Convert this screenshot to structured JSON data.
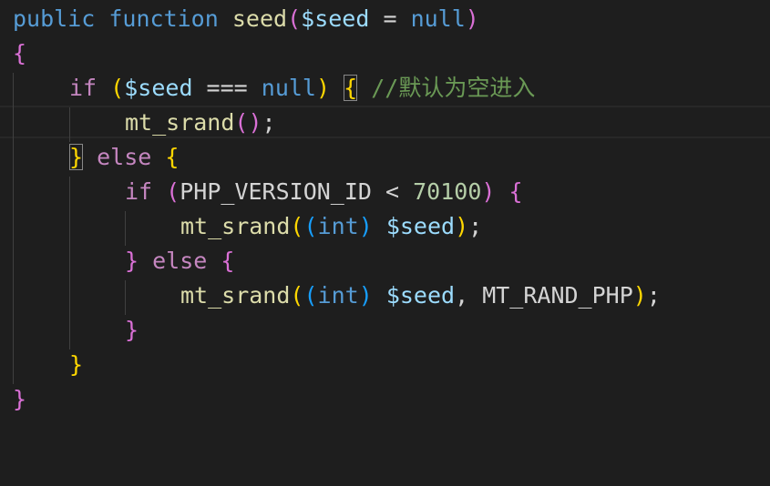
{
  "editor": {
    "language": "php",
    "theme": {
      "background": "#1e1e1e",
      "keyword": "#569cd6",
      "control": "#c586c0",
      "function": "#dcdcaa",
      "variable": "#9cdcfe",
      "number": "#b5cea8",
      "comment": "#6a9955",
      "bracket_level_1": "#da70d6",
      "bracket_level_2": "#ffd700",
      "bracket_level_3": "#179fff"
    },
    "lines": [
      {
        "kw_public": "public",
        "kw_function": "function",
        "fn_name": "seed",
        "open_paren": "(",
        "param": "$seed",
        "eq": " = ",
        "default": "null",
        "close_paren": ")"
      },
      {
        "brace": "{"
      },
      {
        "kw_if": "if",
        "open_paren": "(",
        "var": "$seed",
        "op": " === ",
        "null": "null",
        "close_paren": ")",
        "brace": "{",
        "comment": "//默认为空进入"
      },
      {
        "fn": "mt_srand",
        "parens": "()",
        "semi": ";"
      },
      {
        "close_brace": "}",
        "kw_else": "else",
        "open_brace": "{"
      },
      {
        "kw_if": "if",
        "open_paren": "(",
        "const": "PHP_VERSION_ID",
        "op": " < ",
        "num": "70100",
        "close_paren": ")",
        "brace": "{"
      },
      {
        "fn": "mt_srand",
        "open_paren": "(",
        "cast_open": "(",
        "cast": "int",
        "cast_close": ")",
        "var": "$seed",
        "close_paren": ")",
        "semi": ";"
      },
      {
        "close_brace": "}",
        "kw_else": "else",
        "open_brace": "{"
      },
      {
        "fn": "mt_srand",
        "open_paren": "(",
        "cast_open": "(",
        "cast": "int",
        "cast_close": ")",
        "var": "$seed",
        "sep": ", ",
        "const": "MT_RAND_PHP",
        "close_paren": ")",
        "semi": ";"
      },
      {
        "close_brace": "}"
      },
      {
        "close_brace": "}"
      },
      {
        "close_brace": "}"
      }
    ]
  }
}
